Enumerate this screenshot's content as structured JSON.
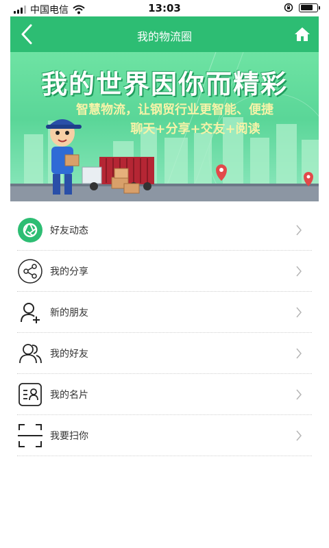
{
  "status_bar": {
    "carrier": "中国电信",
    "time": "13:03"
  },
  "nav": {
    "title": "我的物流圈",
    "back_icon": "chevron-left-icon",
    "home_icon": "home-icon"
  },
  "banner": {
    "title": "我的世界因你而精彩",
    "subtitle_line1": "智慧物流，让钢贸行业更智能、便捷",
    "subtitle_line2": "聊天+分享+交友+阅读"
  },
  "menu": {
    "items": [
      {
        "label": "好友动态",
        "icon": "camera-aperture-icon"
      },
      {
        "label": "我的分享",
        "icon": "share-icon"
      },
      {
        "label": "新的朋友",
        "icon": "add-user-icon"
      },
      {
        "label": "我的好友",
        "icon": "friends-icon"
      },
      {
        "label": "我的名片",
        "icon": "business-card-icon"
      },
      {
        "label": "我要扫你",
        "icon": "scan-icon"
      }
    ]
  },
  "colors": {
    "brand_green": "#2dbd73",
    "banner_text_yellow": "#f6f3a8"
  }
}
